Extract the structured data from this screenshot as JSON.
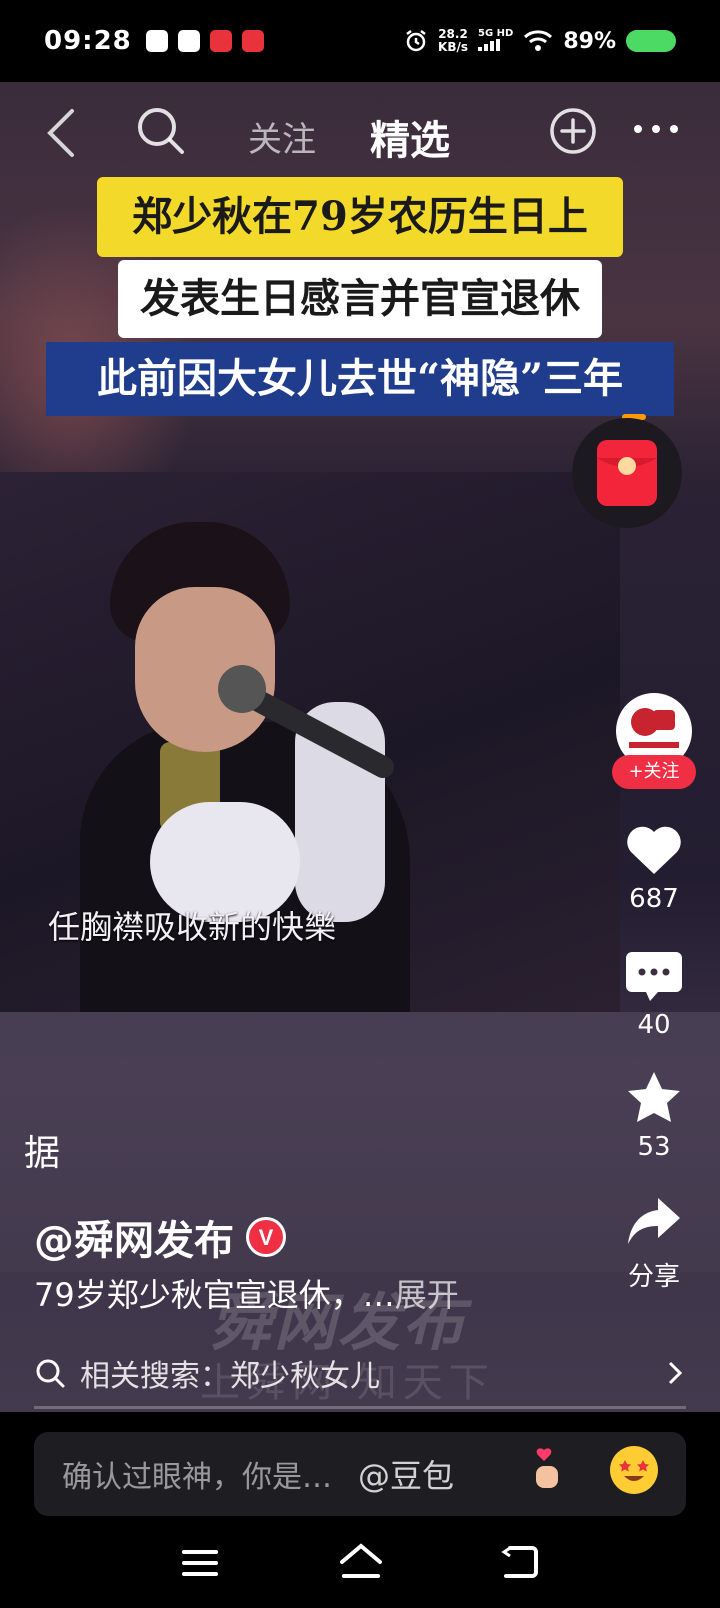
{
  "status_bar": {
    "time": "09:28",
    "net_speed_value": "28.2",
    "net_speed_unit": "KB/s",
    "network": "5G HD",
    "battery_percent": "89%",
    "battery_color": "#4cd964"
  },
  "top_nav": {
    "back_icon": "chevron-left-icon",
    "search_icon": "search-icon",
    "tab_follow": "关注",
    "tab_featured": "精选",
    "add_icon": "plus-circle-icon",
    "more_icon": "more-dots-icon"
  },
  "headline": {
    "line1": "郑少秋在79岁农历生日上",
    "line2": "发表生日感言并官宣退休",
    "line3": "此前因大女儿去世“神隐”三年",
    "line1_bg": "#f2d92a",
    "line2_bg": "#ffffff",
    "line3_bg": "#1f3d8c"
  },
  "video": {
    "subtitle": "任胸襟吸收新的快樂",
    "overlay_char": "据"
  },
  "actions": {
    "follow_label": "+关注",
    "likes": "687",
    "comments": "40",
    "favorites": "53",
    "share_label": "分享"
  },
  "post": {
    "author": "@舜网发布",
    "verified_badge": "V",
    "description": "79岁郑少秋官宣退休，…",
    "expand_label": "展开",
    "watermark": "舜网发布",
    "watermark_sub": "上舜网·知天下",
    "related_search": "相关搜索：郑少秋女儿"
  },
  "comment_bar": {
    "placeholder": "确认过眼神，你是…",
    "mention": "@豆包"
  },
  "colors": {
    "accent_red": "#f02e44",
    "background": "#000000"
  }
}
